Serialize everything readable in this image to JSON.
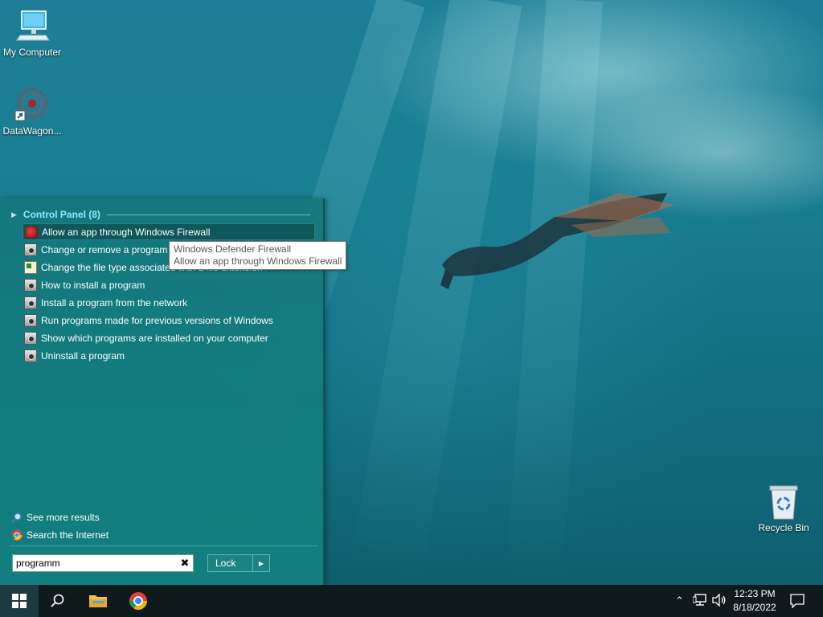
{
  "desktop": {
    "icons": [
      {
        "label": "My Computer",
        "icon": "computer-icon"
      },
      {
        "label": "DataWagon...",
        "icon": "datawagon-shortcut-icon"
      },
      {
        "label": "Recycle Bin",
        "icon": "recycle-bin-icon"
      }
    ]
  },
  "start_menu": {
    "group_header": "Control Panel (8)",
    "results": [
      {
        "label": "Allow an app through Windows Firewall",
        "icon": "firewall-icon",
        "selected": true
      },
      {
        "label": "Change or remove a program",
        "icon": "control-panel-icon"
      },
      {
        "label": "Change the file type associated with a file extension",
        "icon": "file-type-icon"
      },
      {
        "label": "How to install a program",
        "icon": "control-panel-icon"
      },
      {
        "label": "Install a program from the network",
        "icon": "control-panel-icon"
      },
      {
        "label": "Run programs made for previous versions of Windows",
        "icon": "control-panel-icon"
      },
      {
        "label": "Show which programs are installed on your computer",
        "icon": "control-panel-icon"
      },
      {
        "label": "Uninstall a program",
        "icon": "control-panel-icon"
      }
    ],
    "tooltip": {
      "line1": "Windows Defender Firewall",
      "line2": "Allow an app through Windows Firewall"
    },
    "see_more": "See more results",
    "search_internet": "Search the Internet",
    "search_value": "programm",
    "lock_label": "Lock"
  },
  "taskbar": {
    "apps": [
      "start-icon",
      "search-icon",
      "file-explorer-icon",
      "chrome-icon"
    ],
    "time": "12:23 PM",
    "date": "8/18/2022"
  },
  "colors": {
    "accent_header": "#8fe8ff",
    "menu_bg": "#147a7d",
    "taskbar_bg": "#0f1a1c"
  }
}
